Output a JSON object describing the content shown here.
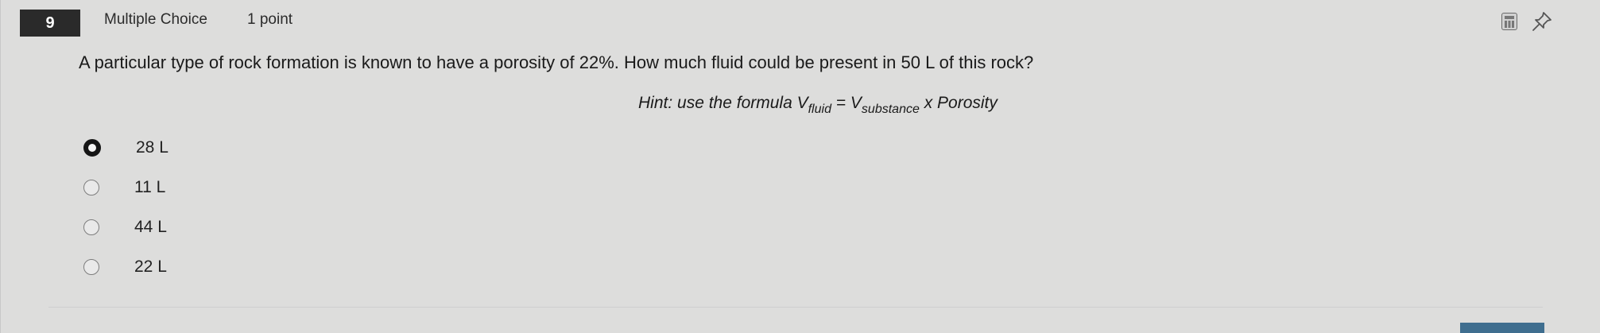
{
  "header": {
    "number": "9",
    "type": "Multiple Choice",
    "points": "1 point",
    "calculator_icon": "calculator-icon",
    "pin_icon": "pushpin-icon"
  },
  "question": {
    "prompt": "A particular type of rock formation is known to have a porosity of 22%. How much fluid could be present in 50 L of this rock?",
    "hint": {
      "prefix": "Hint: use the formula V",
      "fluid_sub": "fluid",
      "equals": " = V",
      "substance_sub": "substance",
      "suffix": " x Porosity"
    }
  },
  "choices": [
    {
      "label": "28 L",
      "selected": true
    },
    {
      "label": "11 L",
      "selected": false
    },
    {
      "label": "44 L",
      "selected": false
    },
    {
      "label": "22 L",
      "selected": false
    }
  ],
  "colors": {
    "background": "#dddddc",
    "number_badge": "#2a2a2a",
    "accent": "#3f6e8f"
  }
}
